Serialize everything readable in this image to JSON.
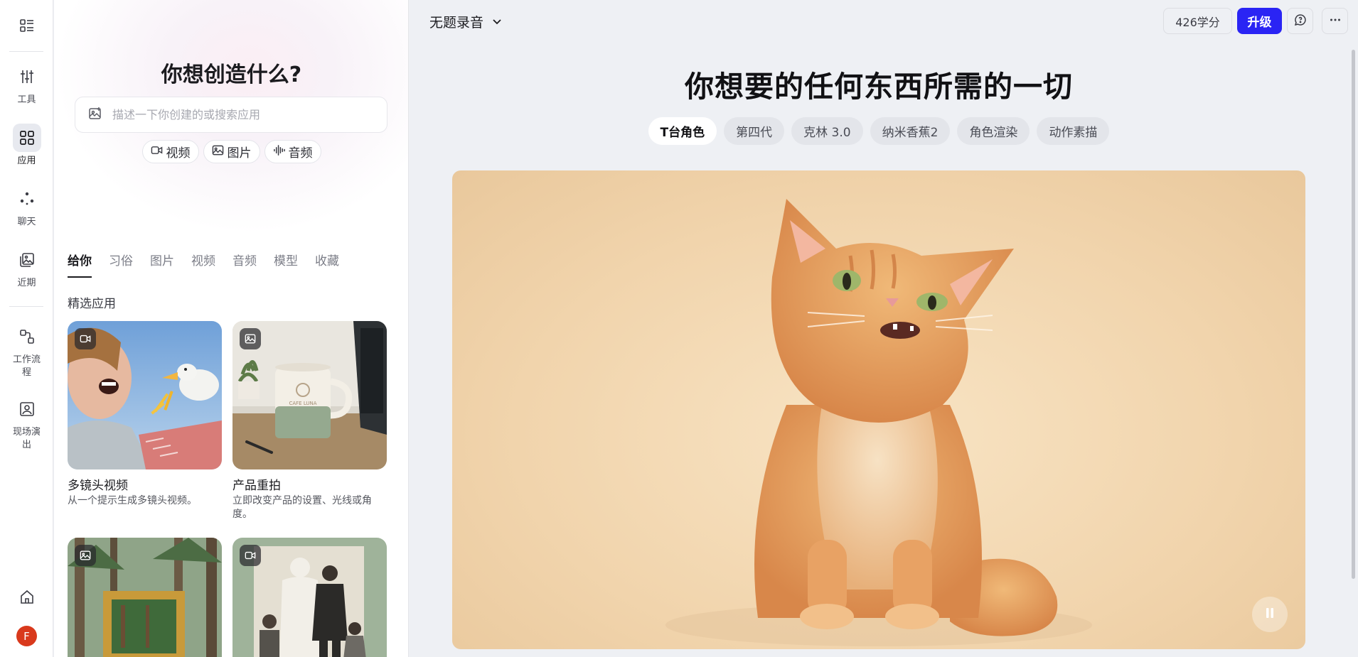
{
  "rail": {
    "items": [
      {
        "label": "工具"
      },
      {
        "label": "应用"
      },
      {
        "label": "聊天"
      },
      {
        "label": "近期"
      },
      {
        "label": "工作流程"
      },
      {
        "label": "现场演出"
      }
    ],
    "avatar_initial": "F"
  },
  "panel": {
    "title": "你想创造什么?",
    "search_placeholder": "描述一下你创建的或搜索应用",
    "chips": [
      {
        "label": "视频",
        "icon": "video-icon"
      },
      {
        "label": "图片",
        "icon": "image-icon"
      },
      {
        "label": "音频",
        "icon": "audio-waveform-icon"
      }
    ],
    "tabs": [
      "给你",
      "习俗",
      "图片",
      "视频",
      "音频",
      "模型",
      "收藏"
    ],
    "active_tab": "给你",
    "section_title": "精选应用",
    "cards": [
      {
        "title": "多镜头视频",
        "desc": "从一个提示生成多镜头视频。",
        "badge": "video-icon",
        "mug_text": "CAFE LUNA"
      },
      {
        "title": "产品重拍",
        "desc": "立即改变产品的设置、光线或角度。",
        "badge": "image-icon"
      },
      {
        "title": "",
        "desc": "",
        "badge": "image-icon"
      },
      {
        "title": "",
        "desc": "",
        "badge": "video-icon"
      }
    ]
  },
  "header": {
    "title": "无题录音",
    "credits": "426学分",
    "upgrade_label": "升级"
  },
  "main": {
    "hero_title": "你想要的任何东西所需的一切",
    "pills": [
      "T台角色",
      "第四代",
      "克林 3.0",
      "纳米香蕉2",
      "角色渲染",
      "动作素描"
    ],
    "active_pill": "T台角色"
  },
  "colors": {
    "accent": "#2a24f4",
    "avatar": "#d9391c",
    "page_bg": "#eef0f4"
  }
}
